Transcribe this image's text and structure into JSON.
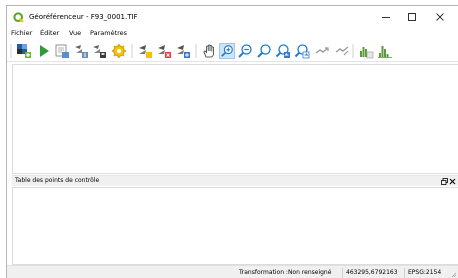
{
  "window": {
    "title": "Géoréférenceur - F93_0001.TIF",
    "minimize_glyph": "minimize-icon",
    "maximize_glyph": "maximize-icon",
    "close_glyph": "close-icon"
  },
  "menu": {
    "items": [
      "Fichier",
      "Éditer",
      "Vue",
      "Paramètres"
    ]
  },
  "toolbar": {
    "active_tool": "zoom-in-icon",
    "icons": [
      "open-raster-icon",
      "start-georeferencing-icon",
      "generate-gdal-script-icon",
      "load-gcp-icon",
      "save-gcp-icon",
      "transformation-settings-icon",
      "add-point-icon",
      "delete-point-icon",
      "move-gcp-icon",
      "pan-icon",
      "zoom-in-icon",
      "zoom-out-icon",
      "zoom-to-layer-icon",
      "zoom-last-icon",
      "zoom-next-icon",
      "link-georeferencer-icon",
      "link-qgis-icon",
      "local-histogram-stretch-icon",
      "full-histogram-stretch-icon"
    ]
  },
  "dock": {
    "title": "Table des points de contrôle"
  },
  "status": {
    "transformation": "Transformation :Non renseigné",
    "coordinates": "463295,6792163",
    "crs": "EPSG:2154"
  },
  "colors": {
    "qgis_green": "#6fb23e",
    "qgis_yellow": "#f2c30d",
    "blue_accent": "#1c7bd2",
    "active_tool_bg": "#cde5f7"
  }
}
